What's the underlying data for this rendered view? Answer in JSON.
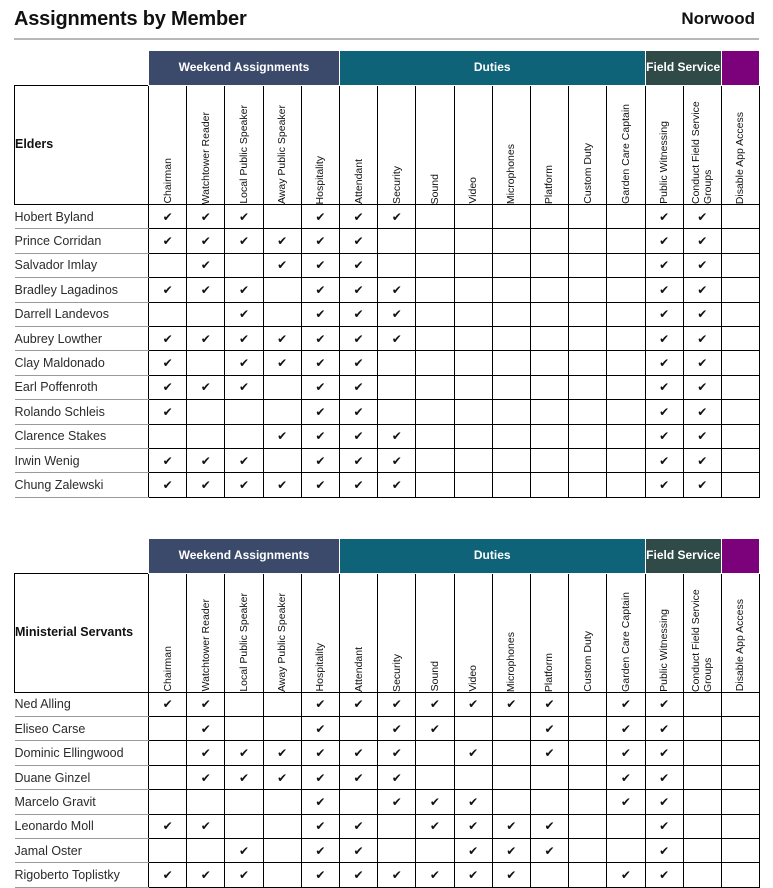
{
  "header": {
    "title": "Assignments by Member",
    "congregation": "Norwood"
  },
  "groups": [
    {
      "label": "Weekend Assignments",
      "span": 5,
      "color": "#3b4a6b",
      "key": "weekend"
    },
    {
      "label": "Duties",
      "span": 8,
      "color": "#0f6378",
      "key": "duties"
    },
    {
      "label": "Field Service",
      "span": 2,
      "color": "#2f4a47",
      "key": "field"
    },
    {
      "label": "",
      "span": 1,
      "color": "#7b027b",
      "key": "disable"
    }
  ],
  "columns": [
    "Chairman",
    "Watchtower Reader",
    "Local Public Speaker",
    "Away Public Speaker",
    "Hospitality",
    "Attendant",
    "Security",
    "Sound",
    "Video",
    "Microphones",
    "Platform",
    "Custom Duty",
    "Garden Care Captain",
    "Public Witnessing",
    "Conduct Field Service Groups",
    "Disable App Access"
  ],
  "icons": {
    "checkmark": "✔"
  },
  "sections": [
    {
      "category": "Elders",
      "rows": [
        {
          "name": "Hobert Byland",
          "marks": [
            1,
            1,
            1,
            0,
            1,
            1,
            1,
            0,
            0,
            0,
            0,
            0,
            0,
            1,
            1,
            0
          ]
        },
        {
          "name": "Prince Corridan",
          "marks": [
            1,
            1,
            1,
            1,
            1,
            1,
            0,
            0,
            0,
            0,
            0,
            0,
            0,
            1,
            1,
            0
          ]
        },
        {
          "name": "Salvador Imlay",
          "marks": [
            0,
            1,
            0,
            1,
            1,
            1,
            0,
            0,
            0,
            0,
            0,
            0,
            0,
            1,
            1,
            0
          ]
        },
        {
          "name": "Bradley Lagadinos",
          "marks": [
            1,
            1,
            1,
            0,
            1,
            1,
            1,
            0,
            0,
            0,
            0,
            0,
            0,
            1,
            1,
            0
          ]
        },
        {
          "name": "Darrell Landevos",
          "marks": [
            0,
            0,
            1,
            0,
            1,
            1,
            1,
            0,
            0,
            0,
            0,
            0,
            0,
            1,
            1,
            0
          ]
        },
        {
          "name": "Aubrey Lowther",
          "marks": [
            1,
            1,
            1,
            1,
            1,
            1,
            1,
            0,
            0,
            0,
            0,
            0,
            0,
            1,
            1,
            0
          ]
        },
        {
          "name": "Clay Maldonado",
          "marks": [
            1,
            0,
            1,
            1,
            1,
            1,
            0,
            0,
            0,
            0,
            0,
            0,
            0,
            1,
            1,
            0
          ]
        },
        {
          "name": "Earl Poffenroth",
          "marks": [
            1,
            1,
            1,
            0,
            1,
            1,
            0,
            0,
            0,
            0,
            0,
            0,
            0,
            1,
            1,
            0
          ]
        },
        {
          "name": "Rolando Schleis",
          "marks": [
            1,
            0,
            0,
            0,
            1,
            1,
            0,
            0,
            0,
            0,
            0,
            0,
            0,
            1,
            1,
            0
          ]
        },
        {
          "name": "Clarence Stakes",
          "marks": [
            0,
            0,
            0,
            1,
            1,
            1,
            1,
            0,
            0,
            0,
            0,
            0,
            0,
            1,
            1,
            0
          ]
        },
        {
          "name": "Irwin Wenig",
          "marks": [
            1,
            1,
            1,
            0,
            1,
            1,
            1,
            0,
            0,
            0,
            0,
            0,
            0,
            1,
            1,
            0
          ]
        },
        {
          "name": "Chung Zalewski",
          "marks": [
            1,
            1,
            1,
            1,
            1,
            1,
            1,
            0,
            0,
            0,
            0,
            0,
            0,
            1,
            1,
            0
          ]
        }
      ]
    },
    {
      "category": "Ministerial Servants",
      "rows": [
        {
          "name": "Ned Alling",
          "marks": [
            1,
            1,
            0,
            0,
            1,
            1,
            1,
            1,
            1,
            1,
            1,
            0,
            1,
            1,
            0,
            0
          ]
        },
        {
          "name": "Eliseo Carse",
          "marks": [
            0,
            1,
            0,
            0,
            1,
            0,
            1,
            1,
            0,
            0,
            1,
            0,
            1,
            1,
            0,
            0
          ]
        },
        {
          "name": "Dominic Ellingwood",
          "marks": [
            0,
            1,
            1,
            1,
            1,
            1,
            1,
            0,
            1,
            0,
            1,
            0,
            1,
            1,
            0,
            0
          ]
        },
        {
          "name": "Duane Ginzel",
          "marks": [
            0,
            1,
            1,
            1,
            1,
            1,
            1,
            0,
            0,
            0,
            0,
            0,
            1,
            1,
            0,
            0
          ]
        },
        {
          "name": "Marcelo Gravit",
          "marks": [
            0,
            0,
            0,
            0,
            1,
            0,
            1,
            1,
            1,
            0,
            0,
            0,
            1,
            1,
            0,
            0
          ]
        },
        {
          "name": "Leonardo Moll",
          "marks": [
            1,
            1,
            0,
            0,
            1,
            1,
            0,
            1,
            1,
            1,
            1,
            0,
            0,
            1,
            0,
            0
          ]
        },
        {
          "name": "Jamal Oster",
          "marks": [
            0,
            0,
            1,
            0,
            1,
            1,
            0,
            0,
            1,
            1,
            1,
            0,
            0,
            1,
            0,
            0
          ]
        },
        {
          "name": "Rigoberto Toplistky",
          "marks": [
            1,
            1,
            1,
            0,
            1,
            1,
            1,
            1,
            1,
            1,
            0,
            0,
            1,
            1,
            0,
            0
          ]
        }
      ]
    }
  ]
}
